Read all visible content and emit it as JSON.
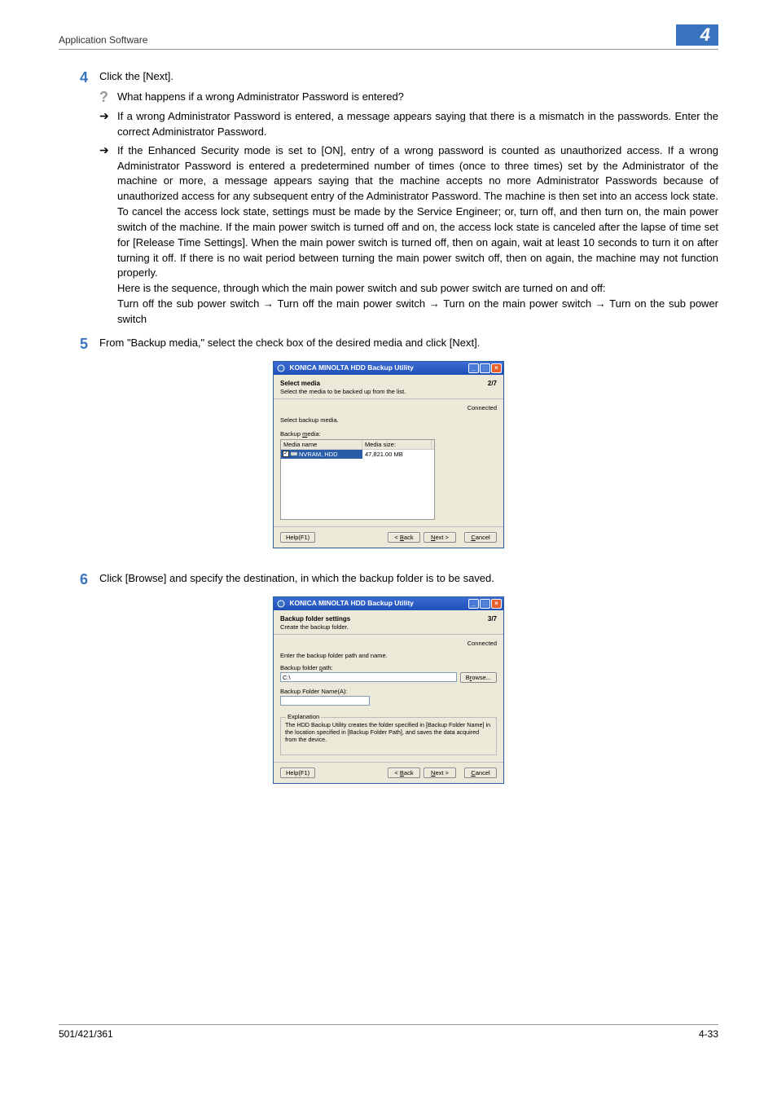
{
  "header": {
    "section": "Application Software",
    "chapter": "4"
  },
  "steps": {
    "s4": {
      "num": "4",
      "text": "Click the [Next].",
      "q": "What happens if a wrong Administrator Password is entered?",
      "a1": "If a wrong Administrator Password is entered, a message appears saying that there is a mismatch in the passwords. Enter the correct Administrator Password.",
      "a2": "If the Enhanced Security mode is set to [ON], entry of a wrong password is counted as unauthorized access. If a wrong Administrator Password is entered a predetermined number of times (once to three times) set by the Administrator of the machine or more, a message appears saying that the machine accepts no more Administrator Passwords because of unauthorized access for any subsequent entry of the Administrator Password. The machine is then set into an access lock state. To cancel the access lock state, settings must be made by the Service Engineer; or, turn off, and then turn on, the main power switch of the machine. If the main power switch is turned off and on, the access lock state is canceled after the lapse of time set for [Release Time Settings]. When the main power switch is turned off, then on again, wait at least 10 seconds to turn it on after turning it off. If there is no wait period between turning the main power switch off, then on again, the machine may not function properly.",
      "a2b": "Here is the sequence, through which the main power switch and sub power switch are turned on and off:",
      "a2c": "Turn off the sub power switch → Turn off the main power switch → Turn on the main power switch → Turn on the sub power switch"
    },
    "s5": {
      "num": "5",
      "text": "From \"Backup media,\" select the check box of the desired media and click [Next]."
    },
    "s6": {
      "num": "6",
      "text": "Click [Browse] and specify the destination, in which the backup folder is to be saved."
    }
  },
  "dialog2": {
    "title": "KONICA MINOLTA HDD Backup Utility",
    "heading": "Select media",
    "sub": "Select the media to be backed up from the list.",
    "page": "2/7",
    "connected": "Connected",
    "selectLabel": "Select backup media.",
    "backupMedia": "Backup media:",
    "col1": "Media name",
    "col2": "Media size:",
    "mediaName": "NVRAM, HDD",
    "mediaSize": "47,821.00 MB",
    "help": "Help(F1)",
    "back": "< Back",
    "next": "Next >",
    "cancel": "Cancel"
  },
  "dialog3": {
    "title": "KONICA MINOLTA HDD Backup Utility",
    "heading": "Backup folder settings",
    "sub": "Create the backup folder.",
    "page": "3/7",
    "connected": "Connected",
    "enterLabel": "Enter the backup folder path and name.",
    "pathLabel": "Backup folder path:",
    "pathValue": "C:\\",
    "browse": "Browse...",
    "nameLabel": "Backup Folder Name(A):",
    "nameValue": "",
    "explLegend": "Explanation",
    "explText": "The HDD Backup Utility creates the folder specified in [Backup Folder Name] in the location specified in [Backup Folder Path], and saves the data acquired from the device.",
    "help": "Help(F1)",
    "back": "< Back",
    "next": "Next >",
    "cancel": "Cancel"
  },
  "footer": {
    "left": "501/421/361",
    "right": "4-33"
  }
}
